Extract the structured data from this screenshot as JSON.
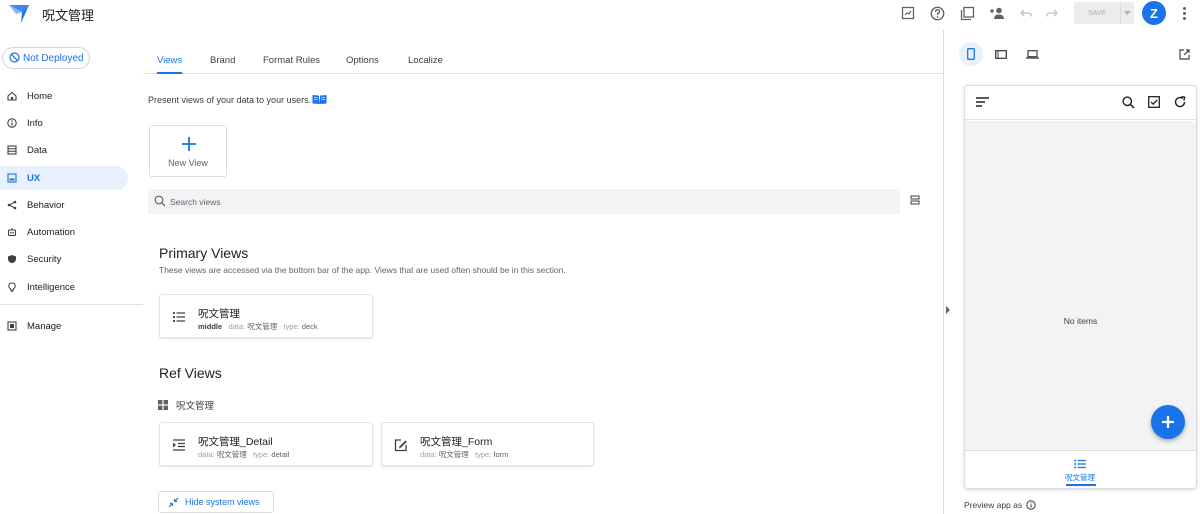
{
  "app": {
    "title": "呪文管理"
  },
  "toolbar": {
    "save_label": "SAVE",
    "avatar_initial": "Z"
  },
  "sidebar": {
    "deploy_status": "Not Deployed",
    "items": [
      {
        "label": "Home",
        "icon": "home-icon"
      },
      {
        "label": "Info",
        "icon": "info-icon"
      },
      {
        "label": "Data",
        "icon": "data-icon"
      },
      {
        "label": "UX",
        "icon": "ux-icon",
        "active": true
      },
      {
        "label": "Behavior",
        "icon": "behavior-icon"
      },
      {
        "label": "Automation",
        "icon": "automation-icon"
      },
      {
        "label": "Security",
        "icon": "shield-icon"
      },
      {
        "label": "Intelligence",
        "icon": "lightbulb-icon"
      },
      {
        "label": "Manage",
        "icon": "manage-icon"
      }
    ]
  },
  "tabs": [
    "Views",
    "Brand",
    "Format Rules",
    "Options",
    "Localize"
  ],
  "main": {
    "intro": "Present views of your data to your users.",
    "new_view_label": "New View",
    "search_placeholder": "Search views",
    "primary": {
      "title": "Primary Views",
      "description": "These views are accessed via the bottom bar of the app. Views that are used often should be in this section.",
      "cards": [
        {
          "name": "呪文管理",
          "position": "middle",
          "data_label": "data:",
          "data_value": "呪文管理",
          "type_label": "type:",
          "type_value": "deck"
        }
      ]
    },
    "ref": {
      "title": "Ref Views",
      "group": "呪文管理",
      "cards": [
        {
          "name": "呪文管理_Detail",
          "data_label": "data:",
          "data_value": "呪文管理",
          "type_label": "type:",
          "type_value": "detail"
        },
        {
          "name": "呪文管理_Form",
          "data_label": "data:",
          "data_value": "呪文管理",
          "type_label": "type:",
          "type_value": "form"
        }
      ]
    },
    "hide_system_views": "Hide system views"
  },
  "preview": {
    "empty_text": "No items",
    "tabbar_label": "呪文管理",
    "preview_as": "Preview app as"
  },
  "colors": {
    "accent": "#1a73e8",
    "active_bg": "#e8f0fe"
  }
}
